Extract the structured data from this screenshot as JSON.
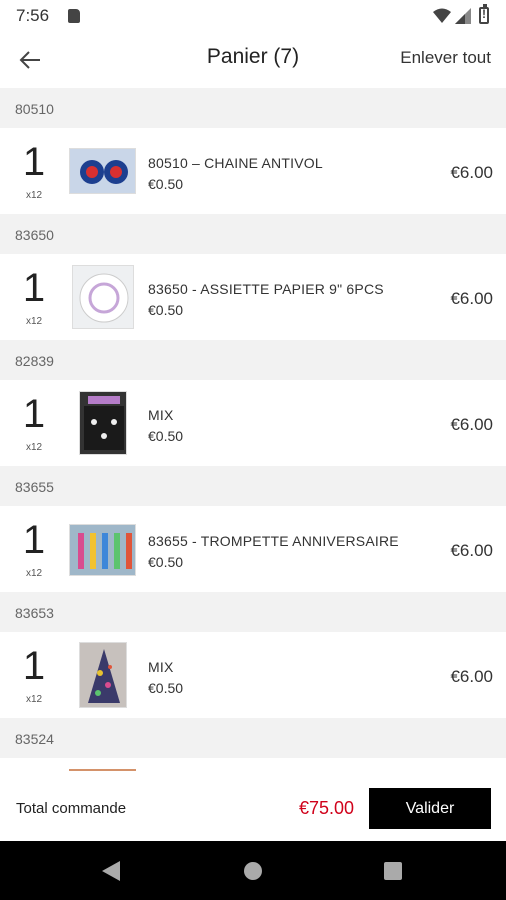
{
  "status_bar": {
    "time": "7:56"
  },
  "header": {
    "title": "Panier (7)",
    "remove_all": "Enlever tout"
  },
  "groups": [
    {
      "code": "80510",
      "qty": "1",
      "pack": "x12",
      "name": "80510 – CHAINE ANTIVOL",
      "unit_price": "€0.50",
      "total": "€6.00",
      "thumb_color": "#c9d6e8"
    },
    {
      "code": "83650",
      "qty": "1",
      "pack": "x12",
      "name": "83650 - ASSIETTE PAPIER 9\" 6PCS",
      "unit_price": "€0.50",
      "total": "€6.00",
      "thumb_color": "#eef0f2"
    },
    {
      "code": "82839",
      "qty": "1",
      "pack": "x12",
      "name": "MIX",
      "unit_price": "€0.50",
      "total": "€6.00",
      "thumb_color": "#333333"
    },
    {
      "code": "83655",
      "qty": "1",
      "pack": "x12",
      "name": "83655 - TROMPETTE ANNIVERSAIRE",
      "unit_price": "€0.50",
      "total": "€6.00",
      "thumb_color": "#9fb7c9"
    },
    {
      "code": "83653",
      "qty": "1",
      "pack": "x12",
      "name": "MIX",
      "unit_price": "€0.50",
      "total": "€6.00",
      "thumb_color": "#c7c1bd"
    },
    {
      "code": "83524",
      "thumb_color": "#d4926a"
    }
  ],
  "footer": {
    "total_label": "Total commande",
    "total_value": "€75.00",
    "validate_label": "Valider"
  },
  "colors": {
    "accent_price": "#d0021b",
    "button_bg": "#000000"
  }
}
